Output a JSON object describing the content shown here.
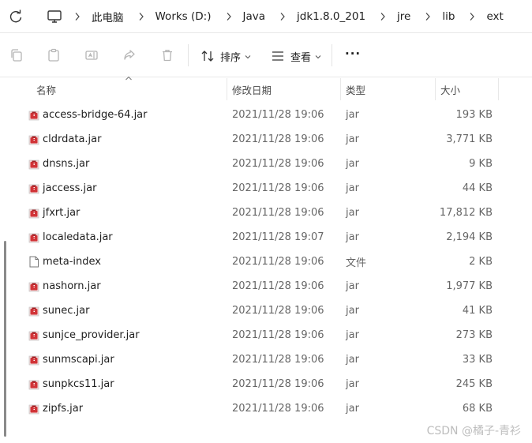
{
  "breadcrumb": [
    "此电脑",
    "Works (D:)",
    "Java",
    "jdk1.8.0_201",
    "jre",
    "lib",
    "ext"
  ],
  "toolbar": {
    "sort_label": "排序",
    "view_label": "查看",
    "more_label": "···"
  },
  "columns": {
    "name": "名称",
    "date": "修改日期",
    "type": "类型",
    "size": "大小"
  },
  "files": [
    {
      "name": "access-bridge-64.jar",
      "date": "2021/11/28 19:06",
      "type": "jar",
      "size": "193 KB",
      "icon": "jar-file-icon"
    },
    {
      "name": "cldrdata.jar",
      "date": "2021/11/28 19:06",
      "type": "jar",
      "size": "3,771 KB",
      "icon": "jar-file-icon"
    },
    {
      "name": "dnsns.jar",
      "date": "2021/11/28 19:06",
      "type": "jar",
      "size": "9 KB",
      "icon": "jar-file-icon"
    },
    {
      "name": "jaccess.jar",
      "date": "2021/11/28 19:06",
      "type": "jar",
      "size": "44 KB",
      "icon": "jar-file-icon"
    },
    {
      "name": "jfxrt.jar",
      "date": "2021/11/28 19:06",
      "type": "jar",
      "size": "17,812 KB",
      "icon": "jar-file-icon"
    },
    {
      "name": "localedata.jar",
      "date": "2021/11/28 19:07",
      "type": "jar",
      "size": "2,194 KB",
      "icon": "jar-file-icon"
    },
    {
      "name": "meta-index",
      "date": "2021/11/28 19:06",
      "type": "文件",
      "size": "2 KB",
      "icon": "generic-file-icon"
    },
    {
      "name": "nashorn.jar",
      "date": "2021/11/28 19:06",
      "type": "jar",
      "size": "1,977 KB",
      "icon": "jar-file-icon"
    },
    {
      "name": "sunec.jar",
      "date": "2021/11/28 19:06",
      "type": "jar",
      "size": "41 KB",
      "icon": "jar-file-icon"
    },
    {
      "name": "sunjce_provider.jar",
      "date": "2021/11/28 19:06",
      "type": "jar",
      "size": "273 KB",
      "icon": "jar-file-icon"
    },
    {
      "name": "sunmscapi.jar",
      "date": "2021/11/28 19:06",
      "type": "jar",
      "size": "33 KB",
      "icon": "jar-file-icon"
    },
    {
      "name": "sunpkcs11.jar",
      "date": "2021/11/28 19:06",
      "type": "jar",
      "size": "245 KB",
      "icon": "jar-file-icon"
    },
    {
      "name": "zipfs.jar",
      "date": "2021/11/28 19:06",
      "type": "jar",
      "size": "68 KB",
      "icon": "jar-file-icon"
    }
  ],
  "watermark": "CSDN @橘子-青衫",
  "colors": {
    "jar_icon": "#d13438",
    "accent": "#0067c0"
  }
}
